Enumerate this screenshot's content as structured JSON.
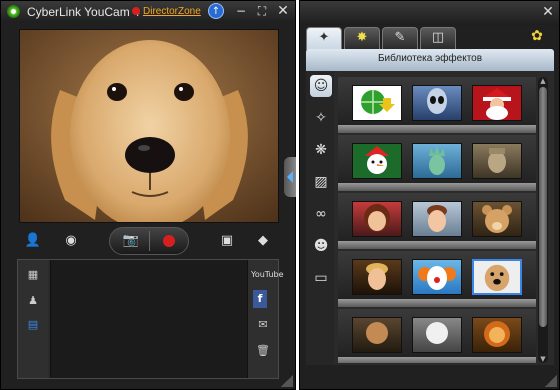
{
  "app": {
    "title": "CyberLink YouCam 4",
    "director_zone": "DirectorZone"
  },
  "titlebar_icons": {
    "update": "update-icon",
    "minimize": "minimize-icon",
    "maximize": "maximize-icon",
    "close": "close-icon"
  },
  "controls": [
    "add-face-icon",
    "eye-icon",
    "camera-icon",
    "record-icon",
    "frame-icon",
    "eraser-icon"
  ],
  "panel": {
    "left_icons": [
      "thumbnails-view-icon",
      "people-icon",
      "film-icon"
    ],
    "right_labels": {
      "youtube": "YouTube"
    },
    "right_icons": [
      "facebook-icon",
      "email-icon",
      "trash-icon"
    ]
  },
  "effects": {
    "tabs": [
      "magic-wand-icon",
      "sparkle-icon",
      "pen-icon",
      "surveillance-camera-icon"
    ],
    "active_tab": 0,
    "library_title": "Библиотека эффектов",
    "categories": [
      "face-effect-icon",
      "magic-wand-icon",
      "particles-icon",
      "frame-icon",
      "mask-icon",
      "emotion-icon",
      "scene-icon"
    ],
    "active_category": 0,
    "items": [
      [
        "globe-download-icon",
        "alien-icon",
        "santa-icon"
      ],
      [
        "snowman-icon",
        "statue-of-liberty-icon",
        "terracotta-warrior-icon"
      ],
      [
        "cartoon-girl-icon",
        "cartoon-boy-icon",
        "teddy-bear-icon"
      ],
      [
        "cartoon-man-icon",
        "clown-icon",
        "dog-icon"
      ],
      [
        "poodle-icon",
        "sheep-icon",
        "lion-icon"
      ]
    ],
    "selected_item": [
      3,
      2
    ]
  },
  "colors": {
    "window_bg": "#202020",
    "accent_blue": "#3a86e8",
    "record_red": "#d62020",
    "director_zone_orange": "#f5a623"
  }
}
